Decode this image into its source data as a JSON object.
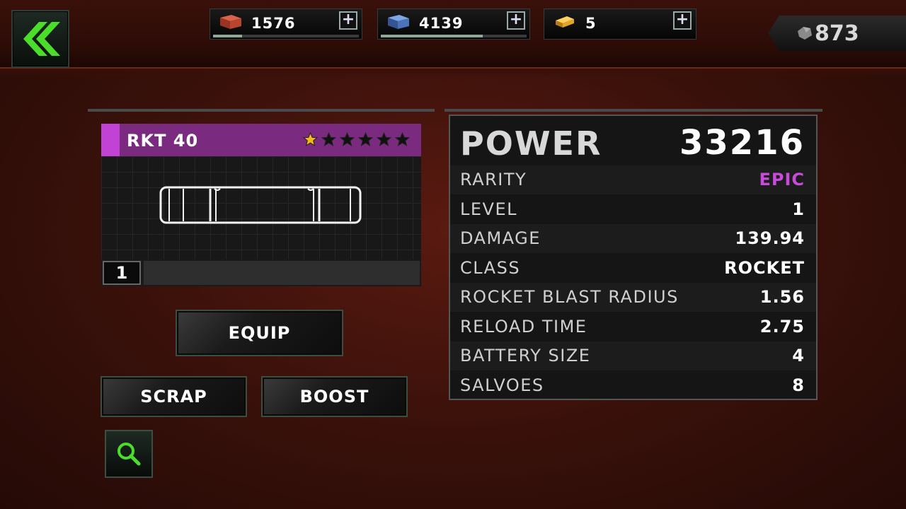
{
  "resources": [
    {
      "name": "bricks",
      "value": "1576",
      "fill": 0.2,
      "color": "#b8452e"
    },
    {
      "name": "blocks",
      "value": "4139",
      "fill": 0.7,
      "color": "#4a73b8"
    },
    {
      "name": "gold",
      "value": "5",
      "fill": 0.0,
      "color": "#e0a52a"
    }
  ],
  "gems": {
    "value": "873"
  },
  "item": {
    "name": "RKT 40",
    "stars_filled": 1,
    "stars_total": 6,
    "level": "1"
  },
  "buttons": {
    "equip": "EQUIP",
    "scrap": "SCRAP",
    "boost": "BOOST"
  },
  "stats": {
    "power_label": "POWER",
    "power_value": "33216",
    "rows": [
      {
        "label": "RARITY",
        "value": "EPIC",
        "color": "#c84ad8"
      },
      {
        "label": "LEVEL",
        "value": "1"
      },
      {
        "label": "DAMAGE",
        "value": "139.94"
      },
      {
        "label": "CLASS",
        "value": "ROCKET"
      },
      {
        "label": "ROCKET BLAST RADIUS",
        "value": "1.56"
      },
      {
        "label": "RELOAD TIME",
        "value": "2.75"
      },
      {
        "label": "BATTERY SIZE",
        "value": "4"
      },
      {
        "label": "SALVOES",
        "value": "8"
      }
    ]
  },
  "icons": {
    "back": "chevron-double-left-icon",
    "search": "magnifier-icon",
    "gems": "gem-icon",
    "star": "star-icon",
    "plus": "plus-icon"
  }
}
